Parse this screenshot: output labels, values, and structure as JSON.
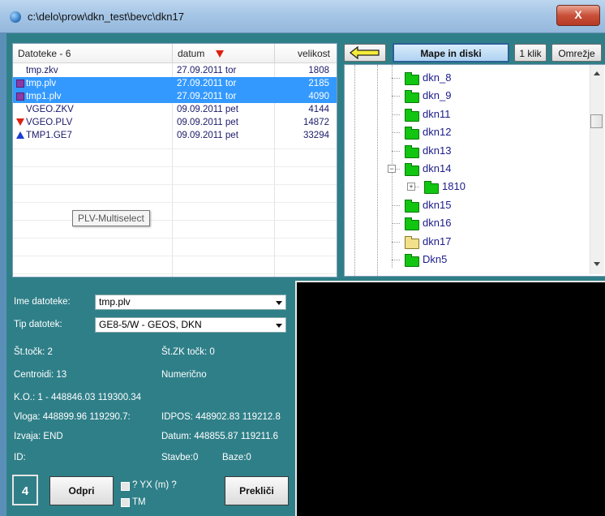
{
  "window": {
    "title": "c:\\delo\\prow\\dkn_test\\bevc\\dkn17",
    "close_glyph": "X"
  },
  "filelist": {
    "col_name": "Datoteke - 6",
    "col_date": "datum",
    "col_size": "velikost",
    "rows": [
      {
        "name": "tmp.zkv",
        "date": "27.09.2011 tor",
        "size": "1808",
        "icon": "none",
        "selected": false
      },
      {
        "name": "tmp.plv",
        "date": "27.09.2011 tor",
        "size": "2185",
        "icon": "multiselect-icon",
        "selected": true
      },
      {
        "name": "tmp1.plv",
        "date": "27.09.2011 tor",
        "size": "4090",
        "icon": "multiselect-icon",
        "selected": true
      },
      {
        "name": "VGEO.ZKV",
        "date": "09.09.2011 pet",
        "size": "4144",
        "icon": "none",
        "selected": false
      },
      {
        "name": "VGEO.PLV",
        "date": "09.09.2011 pet",
        "size": "14872",
        "icon": "red-down-triangle-icon",
        "selected": false
      },
      {
        "name": "TMP1.GE7",
        "date": "09.09.2011 pet",
        "size": "33294",
        "icon": "blue-up-triangle-icon",
        "selected": false
      }
    ],
    "tooltip": "PLV-Multiselect"
  },
  "toolbar": {
    "mape_label": "Mape in diski",
    "klik_label": "1 klik",
    "omrezje_label": "Omrežje"
  },
  "tree": {
    "nodes": [
      {
        "label": "dkn_8",
        "open": false
      },
      {
        "label": "dkn_9",
        "open": false
      },
      {
        "label": "dkn11",
        "open": false
      },
      {
        "label": "dkn12",
        "open": false
      },
      {
        "label": "dkn13",
        "open": false
      },
      {
        "label": "dkn14",
        "open": false,
        "expanded": true
      },
      {
        "label": "1810",
        "open": false,
        "child": true
      },
      {
        "label": "dkn15",
        "open": false
      },
      {
        "label": "dkn16",
        "open": false
      },
      {
        "label": "dkn17",
        "open": true
      },
      {
        "label": "Dkn5",
        "open": false
      }
    ]
  },
  "form": {
    "ime_label": "Ime datoteke:",
    "ime_value": "tmp.plv",
    "tip_label": "Tip datotek:",
    "tip_value": "GE8-5/W - GEOS, DKN"
  },
  "info": {
    "st_tock": "Št.točk: 2",
    "st_zk_tock": "Št.ZK točk: 0",
    "centroidi": "Centroidi: 13",
    "numericno": "Numerično",
    "ko": "K.O.: 1 - 448846.03  119300.34",
    "vloga": "Vloga: 448899.96  119290.7:",
    "idpos": "IDPOS: 448902.83  119212.8",
    "izvaja": "Izvaja: END",
    "datum": "Datum: 448855.87  119211.6",
    "id": "ID:",
    "stavbe": "Stavbe:0",
    "baze": "Baze:0"
  },
  "bottom": {
    "count": "4",
    "odpri_label": "Odpri",
    "yx_label": "? YX (m) ?",
    "tm_label": "TM",
    "preklici_label": "Prekliči"
  },
  "colors": {
    "panel": "#2f7f88",
    "selection": "#3399ff",
    "accent": "#2c5e96"
  }
}
